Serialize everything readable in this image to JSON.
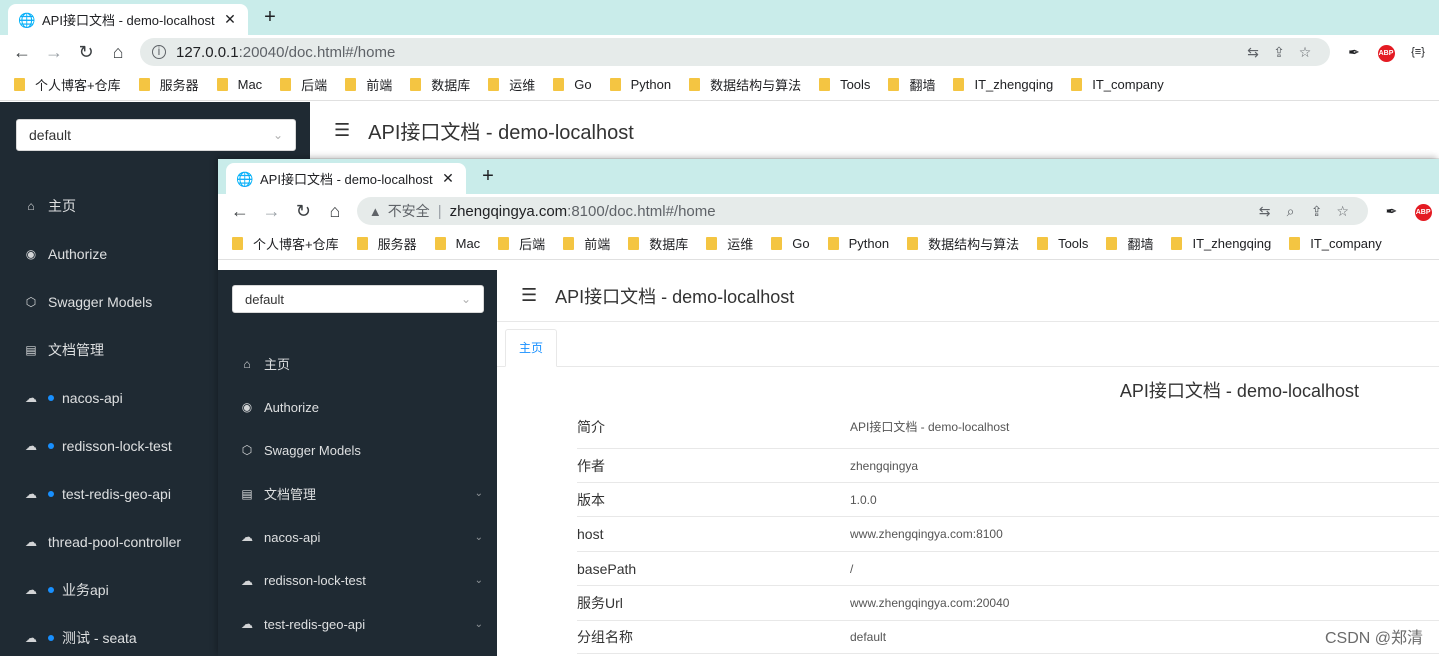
{
  "back_window": {
    "tab": {
      "title": "API接口文档 - demo-localhost",
      "icon": "globe-icon"
    },
    "address": {
      "host": "127.0.0.1",
      "rest": ":20040/doc.html#/home"
    },
    "bookmarks": [
      "个人博客+仓库",
      "服务器",
      "Mac",
      "后端",
      "前端",
      "数据库",
      "运维",
      "Go",
      "Python",
      "数据结构与算法",
      "Tools",
      "翻墙",
      "IT_zhengqing",
      "IT_company"
    ],
    "group_select": "default",
    "header_title": "API接口文档 - demo-localhost",
    "menu": [
      {
        "label": "主页",
        "icon": "home-icon",
        "dot": false
      },
      {
        "label": "Authorize",
        "icon": "lock-icon",
        "dot": false
      },
      {
        "label": "Swagger Models",
        "icon": "cube-icon",
        "dot": false
      },
      {
        "label": "文档管理",
        "icon": "file-icon",
        "dot": false
      },
      {
        "label": "nacos-api",
        "icon": "cloud-icon",
        "dot": true
      },
      {
        "label": "redisson-lock-test",
        "icon": "cloud-icon",
        "dot": true
      },
      {
        "label": "test-redis-geo-api",
        "icon": "cloud-icon",
        "dot": true
      },
      {
        "label": "thread-pool-controller",
        "icon": "cloud-icon",
        "dot": false
      },
      {
        "label": "业务api",
        "icon": "cloud-icon",
        "dot": true
      },
      {
        "label": "测试 - seata",
        "icon": "cloud-icon",
        "dot": true
      }
    ]
  },
  "front_window": {
    "tab": {
      "title": "API接口文档 - demo-localhost",
      "icon": "globe-icon"
    },
    "address": {
      "insecure_label": "不安全",
      "host": "zhengqingya.com",
      "rest": ":8100/doc.html#/home"
    },
    "bookmarks": [
      "个人博客+仓库",
      "服务器",
      "Mac",
      "后端",
      "前端",
      "数据库",
      "运维",
      "Go",
      "Python",
      "数据结构与算法",
      "Tools",
      "翻墙",
      "IT_zhengqing",
      "IT_company"
    ],
    "group_select": "default",
    "header_title": "API接口文档 - demo-localhost",
    "menu": [
      {
        "label": "主页",
        "icon": "home-icon",
        "dot": false,
        "chevron": false
      },
      {
        "label": "Authorize",
        "icon": "lock-icon",
        "dot": false,
        "chevron": false
      },
      {
        "label": "Swagger Models",
        "icon": "cube-icon",
        "dot": false,
        "chevron": false
      },
      {
        "label": "文档管理",
        "icon": "file-icon",
        "dot": false,
        "chevron": true
      },
      {
        "label": "nacos-api",
        "icon": "cloud-icon",
        "dot": false,
        "chevron": true
      },
      {
        "label": "redisson-lock-test",
        "icon": "cloud-icon",
        "dot": false,
        "chevron": true
      },
      {
        "label": "test-redis-geo-api",
        "icon": "cloud-icon",
        "dot": false,
        "chevron": true
      }
    ],
    "content_tab": "主页",
    "doc_title": "API接口文档 - demo-localhost",
    "info_rows": [
      {
        "key": "简介",
        "value": "API接口文档 - demo-localhost"
      },
      {
        "key": "作者",
        "value": "zhengqingya"
      },
      {
        "key": "版本",
        "value": "1.0.0"
      },
      {
        "key": "host",
        "value": "www.zhengqingya.com:8100"
      },
      {
        "key": "basePath",
        "value": "/"
      },
      {
        "key": "服务Url",
        "value": "www.zhengqingya.com:20040"
      },
      {
        "key": "分组名称",
        "value": "default"
      }
    ]
  },
  "watermark": "CSDN @郑清"
}
